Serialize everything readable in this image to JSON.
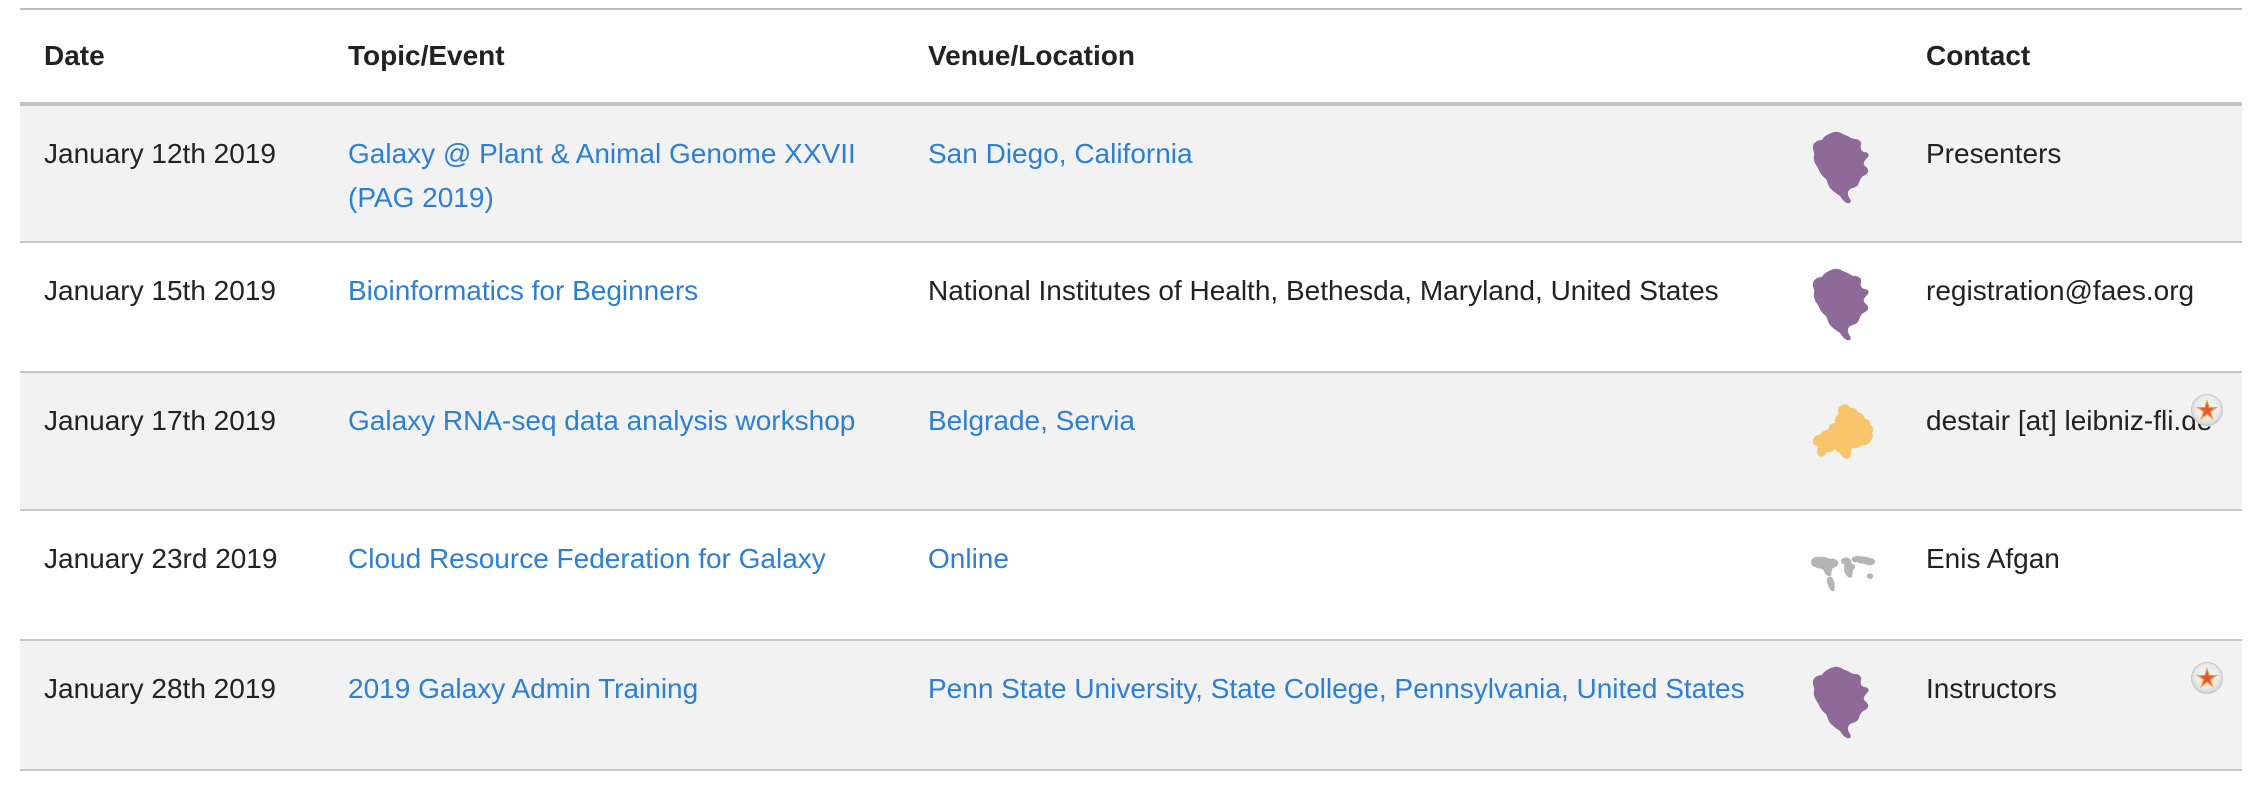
{
  "headers": {
    "date": "Date",
    "topic": "Topic/Event",
    "venue": "Venue/Location",
    "contact": "Contact"
  },
  "rows": [
    {
      "date": "January 12th 2019",
      "topic": "Galaxy @ Plant & Animal Genome XXVII (PAG 2019)",
      "topic_is_link": true,
      "venue": "San Diego, California",
      "venue_is_link": true,
      "region_icon": "north-america-map-icon",
      "contact": "Presenters",
      "badge": false
    },
    {
      "date": "January 15th 2019",
      "topic": "Bioinformatics for Beginners",
      "topic_is_link": true,
      "venue": "National Institutes of Health, Bethesda, Maryland, United States",
      "venue_is_link": false,
      "region_icon": "north-america-map-icon",
      "contact": "registration@faes.org",
      "badge": false
    },
    {
      "date": "January 17th 2019",
      "topic": "Galaxy RNA-seq data analysis workshop",
      "topic_is_link": true,
      "venue": "Belgrade, Servia",
      "venue_is_link": true,
      "region_icon": "europe-map-icon",
      "contact": "destair [at] leibniz-fli.de",
      "badge": true
    },
    {
      "date": "January 23rd 2019",
      "topic": "Cloud Resource Federation for Galaxy",
      "topic_is_link": true,
      "venue": "Online",
      "venue_is_link": true,
      "region_icon": "world-map-icon",
      "contact": "Enis Afgan",
      "badge": false
    },
    {
      "date": "January 28th 2019",
      "topic": "2019 Galaxy Admin Training",
      "topic_is_link": true,
      "venue": "Penn State University, State College, Pennsylvania, United States",
      "venue_is_link": true,
      "region_icon": "north-america-map-icon",
      "contact": "Instructors",
      "badge": true
    }
  ],
  "colors": {
    "link": "#2c7fd6",
    "north_america": "#8e6a98",
    "europe": "#f6c56b",
    "world": "#b5b5b5"
  }
}
